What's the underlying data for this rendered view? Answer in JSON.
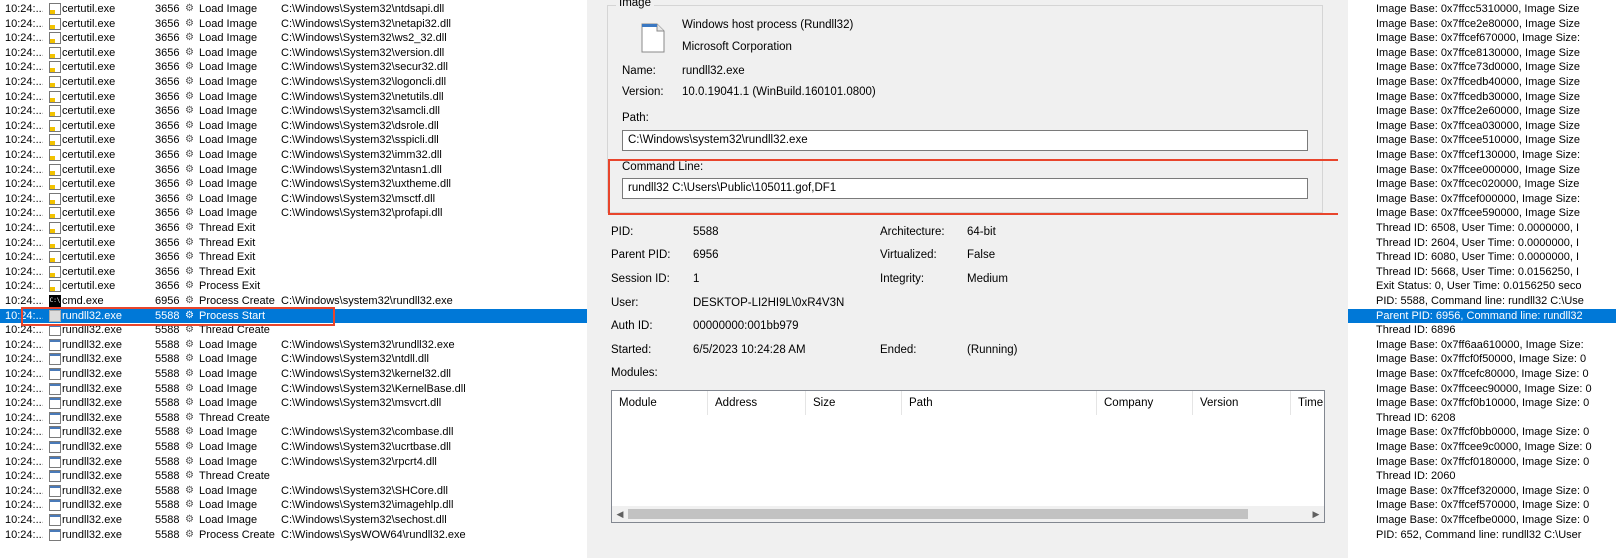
{
  "events": [
    {
      "time": "10:24:...",
      "icon": "certificate-icon",
      "process": "certutil.exe",
      "pid": "3656",
      "op": "Load Image",
      "path": "C:\\Windows\\System32\\ntdsapi.dll"
    },
    {
      "time": "10:24:...",
      "icon": "certificate-icon",
      "process": "certutil.exe",
      "pid": "3656",
      "op": "Load Image",
      "path": "C:\\Windows\\System32\\netapi32.dll"
    },
    {
      "time": "10:24:...",
      "icon": "certificate-icon",
      "process": "certutil.exe",
      "pid": "3656",
      "op": "Load Image",
      "path": "C:\\Windows\\System32\\ws2_32.dll"
    },
    {
      "time": "10:24:...",
      "icon": "certificate-icon",
      "process": "certutil.exe",
      "pid": "3656",
      "op": "Load Image",
      "path": "C:\\Windows\\System32\\version.dll"
    },
    {
      "time": "10:24:...",
      "icon": "certificate-icon",
      "process": "certutil.exe",
      "pid": "3656",
      "op": "Load Image",
      "path": "C:\\Windows\\System32\\secur32.dll"
    },
    {
      "time": "10:24:...",
      "icon": "certificate-icon",
      "process": "certutil.exe",
      "pid": "3656",
      "op": "Load Image",
      "path": "C:\\Windows\\System32\\logoncli.dll"
    },
    {
      "time": "10:24:...",
      "icon": "certificate-icon",
      "process": "certutil.exe",
      "pid": "3656",
      "op": "Load Image",
      "path": "C:\\Windows\\System32\\netutils.dll"
    },
    {
      "time": "10:24:...",
      "icon": "certificate-icon",
      "process": "certutil.exe",
      "pid": "3656",
      "op": "Load Image",
      "path": "C:\\Windows\\System32\\samcli.dll"
    },
    {
      "time": "10:24:...",
      "icon": "certificate-icon",
      "process": "certutil.exe",
      "pid": "3656",
      "op": "Load Image",
      "path": "C:\\Windows\\System32\\dsrole.dll"
    },
    {
      "time": "10:24:...",
      "icon": "certificate-icon",
      "process": "certutil.exe",
      "pid": "3656",
      "op": "Load Image",
      "path": "C:\\Windows\\System32\\sspicli.dll"
    },
    {
      "time": "10:24:...",
      "icon": "certificate-icon",
      "process": "certutil.exe",
      "pid": "3656",
      "op": "Load Image",
      "path": "C:\\Windows\\System32\\imm32.dll"
    },
    {
      "time": "10:24:...",
      "icon": "certificate-icon",
      "process": "certutil.exe",
      "pid": "3656",
      "op": "Load Image",
      "path": "C:\\Windows\\System32\\ntasn1.dll"
    },
    {
      "time": "10:24:...",
      "icon": "certificate-icon",
      "process": "certutil.exe",
      "pid": "3656",
      "op": "Load Image",
      "path": "C:\\Windows\\System32\\uxtheme.dll"
    },
    {
      "time": "10:24:...",
      "icon": "certificate-icon",
      "process": "certutil.exe",
      "pid": "3656",
      "op": "Load Image",
      "path": "C:\\Windows\\System32\\msctf.dll"
    },
    {
      "time": "10:24:...",
      "icon": "certificate-icon",
      "process": "certutil.exe",
      "pid": "3656",
      "op": "Load Image",
      "path": "C:\\Windows\\System32\\profapi.dll"
    },
    {
      "time": "10:24:...",
      "icon": "certificate-icon",
      "process": "certutil.exe",
      "pid": "3656",
      "op": "Thread Exit",
      "path": ""
    },
    {
      "time": "10:24:...",
      "icon": "certificate-icon",
      "process": "certutil.exe",
      "pid": "3656",
      "op": "Thread Exit",
      "path": ""
    },
    {
      "time": "10:24:...",
      "icon": "certificate-icon",
      "process": "certutil.exe",
      "pid": "3656",
      "op": "Thread Exit",
      "path": ""
    },
    {
      "time": "10:24:...",
      "icon": "certificate-icon",
      "process": "certutil.exe",
      "pid": "3656",
      "op": "Thread Exit",
      "path": ""
    },
    {
      "time": "10:24:...",
      "icon": "certificate-icon",
      "process": "certutil.exe",
      "pid": "3656",
      "op": "Process Exit",
      "path": ""
    },
    {
      "time": "10:24:...",
      "icon": "cmd-icon",
      "process": "cmd.exe",
      "pid": "6956",
      "op": "Process Create",
      "path": "C:\\Windows\\system32\\rundll32.exe"
    },
    {
      "time": "10:24:...",
      "icon": "rundll-icon",
      "process": "rundll32.exe",
      "pid": "5588",
      "op": "Process Start",
      "path": "",
      "selected": true
    },
    {
      "time": "10:24:...",
      "icon": "rundll-icon",
      "process": "rundll32.exe",
      "pid": "5588",
      "op": "Thread Create",
      "path": ""
    },
    {
      "time": "10:24:...",
      "icon": "rundll-icon",
      "process": "rundll32.exe",
      "pid": "5588",
      "op": "Load Image",
      "path": "C:\\Windows\\System32\\rundll32.exe"
    },
    {
      "time": "10:24:...",
      "icon": "rundll-icon",
      "process": "rundll32.exe",
      "pid": "5588",
      "op": "Load Image",
      "path": "C:\\Windows\\System32\\ntdll.dll"
    },
    {
      "time": "10:24:...",
      "icon": "rundll-icon",
      "process": "rundll32.exe",
      "pid": "5588",
      "op": "Load Image",
      "path": "C:\\Windows\\System32\\kernel32.dll"
    },
    {
      "time": "10:24:...",
      "icon": "rundll-icon",
      "process": "rundll32.exe",
      "pid": "5588",
      "op": "Load Image",
      "path": "C:\\Windows\\System32\\KernelBase.dll"
    },
    {
      "time": "10:24:...",
      "icon": "rundll-icon",
      "process": "rundll32.exe",
      "pid": "5588",
      "op": "Load Image",
      "path": "C:\\Windows\\System32\\msvcrt.dll"
    },
    {
      "time": "10:24:...",
      "icon": "rundll-icon",
      "process": "rundll32.exe",
      "pid": "5588",
      "op": "Thread Create",
      "path": ""
    },
    {
      "time": "10:24:...",
      "icon": "rundll-icon",
      "process": "rundll32.exe",
      "pid": "5588",
      "op": "Load Image",
      "path": "C:\\Windows\\System32\\combase.dll"
    },
    {
      "time": "10:24:...",
      "icon": "rundll-icon",
      "process": "rundll32.exe",
      "pid": "5588",
      "op": "Load Image",
      "path": "C:\\Windows\\System32\\ucrtbase.dll"
    },
    {
      "time": "10:24:...",
      "icon": "rundll-icon",
      "process": "rundll32.exe",
      "pid": "5588",
      "op": "Load Image",
      "path": "C:\\Windows\\System32\\rpcrt4.dll"
    },
    {
      "time": "10:24:...",
      "icon": "rundll-icon",
      "process": "rundll32.exe",
      "pid": "5588",
      "op": "Thread Create",
      "path": ""
    },
    {
      "time": "10:24:...",
      "icon": "rundll-icon",
      "process": "rundll32.exe",
      "pid": "5588",
      "op": "Load Image",
      "path": "C:\\Windows\\System32\\SHCore.dll"
    },
    {
      "time": "10:24:...",
      "icon": "rundll-icon",
      "process": "rundll32.exe",
      "pid": "5588",
      "op": "Load Image",
      "path": "C:\\Windows\\System32\\imagehlp.dll"
    },
    {
      "time": "10:24:...",
      "icon": "rundll-icon",
      "process": "rundll32.exe",
      "pid": "5588",
      "op": "Load Image",
      "path": "C:\\Windows\\System32\\sechost.dll"
    },
    {
      "time": "10:24:...",
      "icon": "rundll-icon",
      "process": "rundll32.exe",
      "pid": "5588",
      "op": "Process Create",
      "path": "C:\\Windows\\SysWOW64\\rundll32.exe"
    }
  ],
  "image_group": {
    "title": "Image",
    "description": "Windows host process (Rundll32)",
    "company": "Microsoft Corporation",
    "name_label": "Name:",
    "name": "rundll32.exe",
    "version_label": "Version:",
    "version": "10.0.19041.1 (WinBuild.160101.0800)",
    "path_label": "Path:",
    "path": "C:\\Windows\\system32\\rundll32.exe",
    "cmdline_label": "Command Line:",
    "cmdline": "rundll32  C:\\Users\\Public\\105011.gof,DF1"
  },
  "details": {
    "pid_label": "PID:",
    "pid": "5588",
    "parent_pid_label": "Parent PID:",
    "parent_pid": "6956",
    "session_label": "Session ID:",
    "session": "1",
    "user_label": "User:",
    "user": "DESKTOP-LI2HI9L\\0xR4V3N",
    "auth_label": "Auth ID:",
    "auth": "00000000:001bb979",
    "started_label": "Started:",
    "started": "6/5/2023 10:24:28 AM",
    "arch_label": "Architecture:",
    "arch": "64-bit",
    "virt_label": "Virtualized:",
    "virt": "False",
    "integrity_label": "Integrity:",
    "integrity": "Medium",
    "ended_label": "Ended:",
    "ended": "(Running)",
    "modules_label": "Modules:"
  },
  "modules_columns": [
    "Module",
    "Address",
    "Size",
    "Path",
    "Company",
    "Version",
    "Time"
  ],
  "right_lines": [
    "Image Base: 0x7ffcc5310000, Image Size",
    "Image Base: 0x7ffce2e80000, Image Size",
    "Image Base: 0x7ffcef670000, Image Size:",
    "Image Base: 0x7ffce8130000, Image Size",
    "Image Base: 0x7ffce73d0000, Image Size",
    "Image Base: 0x7ffcedb40000, Image Size",
    "Image Base: 0x7ffcedb30000, Image Size",
    "Image Base: 0x7ffce2e60000, Image Size",
    "Image Base: 0x7ffcea030000, Image Size",
    "Image Base: 0x7ffcee510000, Image Size",
    "Image Base: 0x7ffcef130000, Image Size:",
    "Image Base: 0x7ffcee000000, Image Size",
    "Image Base: 0x7ffcec020000, Image Size",
    "Image Base: 0x7ffcef000000, Image Size:",
    "Image Base: 0x7ffcee590000, Image Size",
    "Thread ID: 6508, User Time: 0.0000000, I",
    "Thread ID: 2604, User Time: 0.0000000, I",
    "Thread ID: 6080, User Time: 0.0000000, I",
    "Thread ID: 5668, User Time: 0.0156250, I",
    "Exit Status: 0, User Time: 0.0156250 seco",
    "PID: 5588, Command line: rundll32  C:\\Use",
    "Parent PID: 6956, Command line: rundll32",
    "Thread ID: 6896",
    "Image Base: 0x7ff6aa610000, Image Size:",
    "Image Base: 0x7ffcf0f50000, Image Size: 0",
    "Image Base: 0x7ffcefc80000, Image Size: 0",
    "Image Base: 0x7ffceec90000, Image Size: 0",
    "Image Base: 0x7ffcf0b10000, Image Size: 0",
    "Thread ID: 6208",
    "Image Base: 0x7ffcf0bb0000, Image Size: 0",
    "Image Base: 0x7ffcee9c0000, Image Size: 0",
    "Image Base: 0x7ffcf0180000, Image Size: 0",
    "Thread ID: 2060",
    "Image Base: 0x7ffcef320000, Image Size: 0",
    "Image Base: 0x7ffcef570000, Image Size: 0",
    "Image Base: 0x7ffcefbe0000, Image Size: 0",
    "PID: 652, Command line: rundll32  C:\\User"
  ],
  "right_selected_index": 21,
  "colors": {
    "selection": "#0078d7",
    "highlight": "#e8452c",
    "panel": "#f0f0f0"
  }
}
